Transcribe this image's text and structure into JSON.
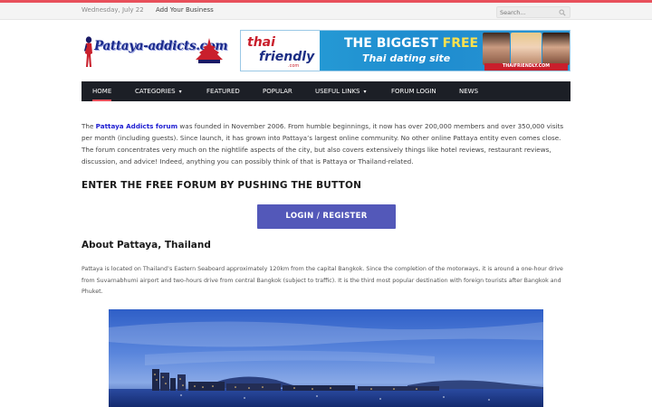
{
  "topbar": {
    "date": "Wednesday, July 22",
    "add_business": "Add Your Business",
    "search_placeholder": "Search..."
  },
  "logo": {
    "text": "Pattaya-addicts.com"
  },
  "ad": {
    "brand_line1": "thai",
    "brand_line2": "friendly",
    "brand_sub": ".com",
    "headline_pre": "THE BIGGEST ",
    "headline_free": "FREE",
    "subline": "Thai dating site",
    "url": "THAIFRIENDLY.COM"
  },
  "nav": {
    "items": [
      {
        "label": "HOME"
      },
      {
        "label": "CATEGORIES"
      },
      {
        "label": "FEATURED"
      },
      {
        "label": "POPULAR"
      },
      {
        "label": "USEFUL LINKS"
      },
      {
        "label": "FORUM LOGIN"
      },
      {
        "label": "NEWS"
      }
    ]
  },
  "intro": {
    "prefix": "The ",
    "link": "Pattaya Addicts forum",
    "body": " was founded in November 2006. From humble beginnings, it now has over 200,000 members and over 350,000 visits per month (including guests). Since launch, it has grown into Pattaya’s largest online community. No other online Pattaya entity even comes close. The forum concentrates very much on the nightlife aspects of the city, but also covers extensively things like hotel reviews, restaurant reviews, discussion, and advice! Indeed, anything you can possibly think of that is Pattaya or Thailand-related."
  },
  "forum_heading": "ENTER THE FREE FORUM BY PUSHING THE BUTTON",
  "login_button": "LOGIN / REGISTER",
  "about_heading": "About Pattaya, Thailand",
  "about_text": "Pattaya is located on Thailand’s Eastern Seaboard approximately 120km from the capital Bangkok. Since the completion of the motorways, it is around a one-hour drive from Suvarnabhumi airport and two-hours drive from central Bangkok (subject to traffic). It is the third most popular destination with foreign tourists after Bangkok and Phuket.",
  "colors": {
    "accent": "#e8505b",
    "nav_bg": "#1c1f26",
    "button": "#5358b9",
    "link": "#1d1dd1"
  }
}
